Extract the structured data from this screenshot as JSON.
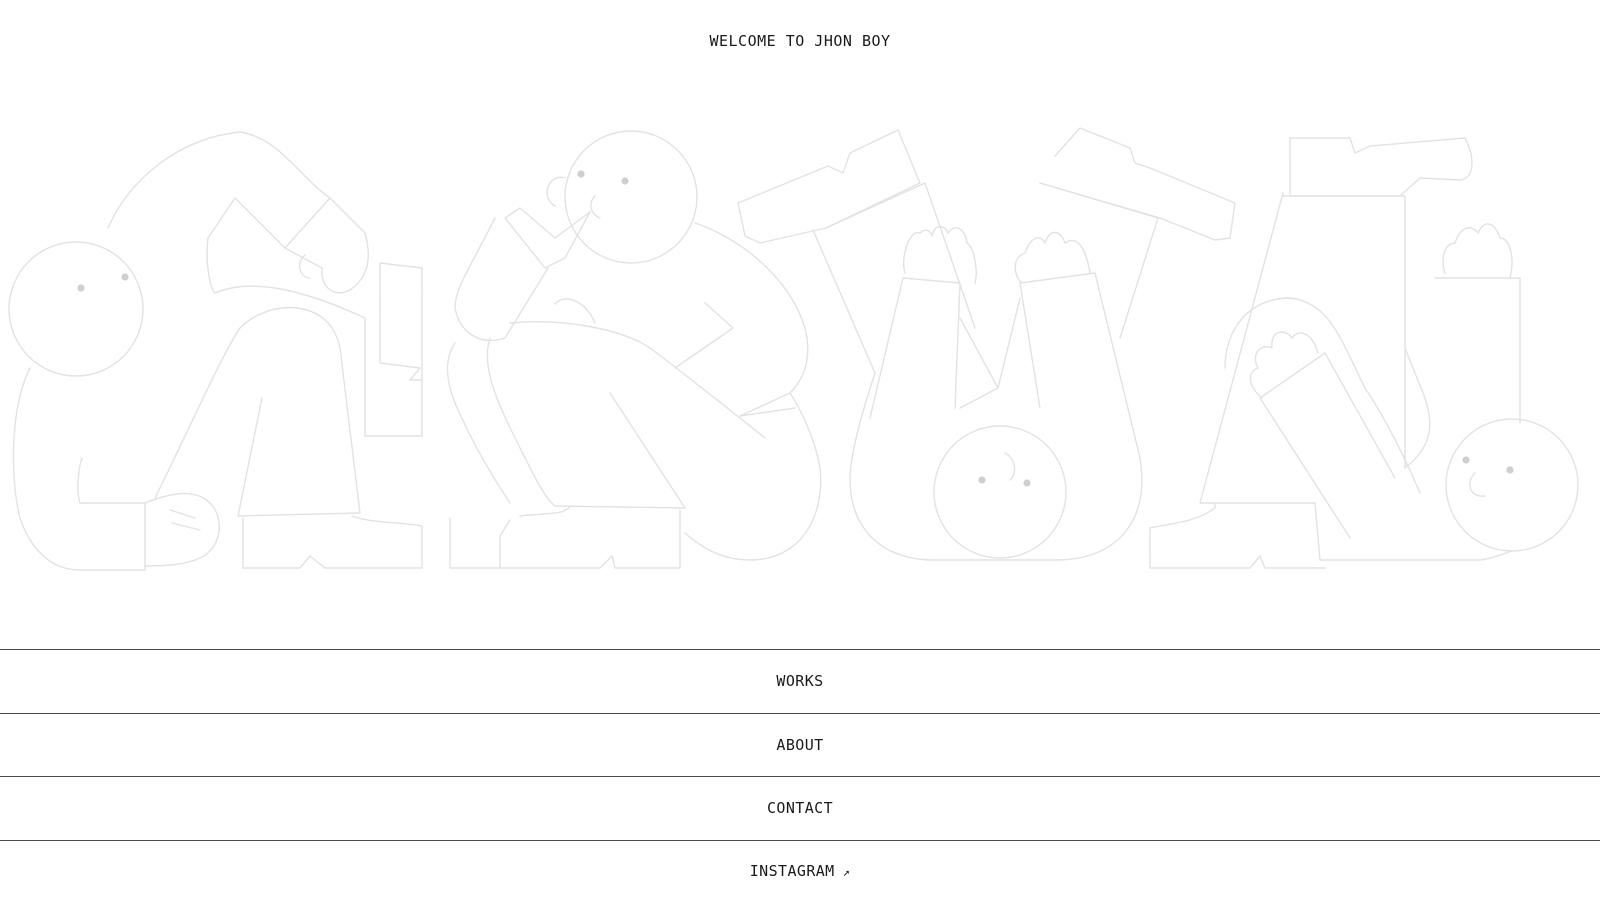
{
  "header": {
    "welcome_text": "WELCOME TO JHON BOY"
  },
  "hero": {
    "illustration_icon": "jhon-boy-figures-illustration",
    "line_color": "#e2e2e2",
    "eye_color": "#cfcfcf"
  },
  "nav": {
    "items": [
      {
        "label": "WORKS"
      },
      {
        "label": "ABOUT"
      },
      {
        "label": "CONTACT"
      },
      {
        "label": "INSTAGRAM",
        "icon": "external-arrow-icon",
        "icon_glyph": "↗"
      }
    ],
    "border_color": "#4a4a4a"
  }
}
